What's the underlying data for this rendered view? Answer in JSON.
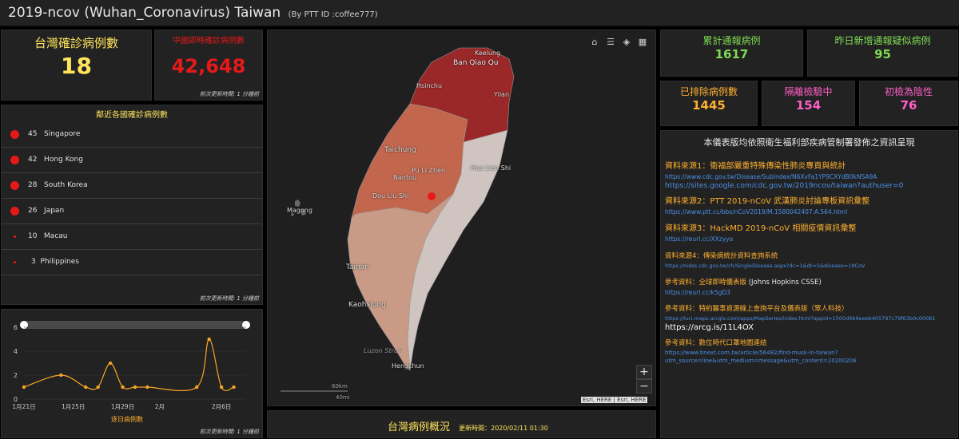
{
  "header": {
    "title": "2019-ncov (Wuhan_Coronavirus) Taiwan",
    "subtitle": "(By PTT ID :coffee777)"
  },
  "taiwan_cases": {
    "label": "台灣確診病例數",
    "value": "18"
  },
  "china_cases": {
    "label": "中國即時確診病例數",
    "value": "42,648",
    "note": "前次更新時間: 1 分鐘前"
  },
  "neighbors": {
    "title": "鄰近各國確診病例數",
    "note": "前次更新時間: 1 分鐘前",
    "items": [
      {
        "count": "45",
        "country": "Singapore"
      },
      {
        "count": "42",
        "country": "Hong Kong"
      },
      {
        "count": "28",
        "country": "South Korea"
      },
      {
        "count": "26",
        "country": "Japan"
      },
      {
        "count": "10",
        "country": "Macau"
      },
      {
        "count": "3",
        "country": "Philippines"
      }
    ]
  },
  "daily_chart": {
    "note": "前次更新時間: 1 分鐘前",
    "colors": {
      "line": "#f5a623",
      "grid": "#3a3a3a",
      "track": "#4a4a4a"
    }
  },
  "chart_data": {
    "type": "line",
    "xlabel": "逐日病例數",
    "ylim": [
      0,
      6
    ],
    "yticks": [
      "0",
      "2",
      "4",
      "6"
    ],
    "xticks": [
      "1月21日",
      "1月25日",
      "1月29日",
      "2月",
      "2月6日"
    ],
    "xtick_positions": [
      0,
      4,
      8,
      11,
      16
    ],
    "x": [
      0,
      3,
      5,
      6,
      7,
      8,
      9,
      10,
      14,
      15,
      16,
      17
    ],
    "values": [
      1,
      2,
      1,
      1,
      3,
      1,
      1,
      1,
      1,
      5,
      1,
      1
    ],
    "xmax": 18
  },
  "map": {
    "labels": [
      "Keelung",
      "Ban Qiao Qu",
      "Hsinchu",
      "Yilan",
      "Taichung",
      "Pu Li Zhen",
      "Nantou",
      "Hua Lien Shi",
      "Dou Liu Shi",
      "Magong",
      "Tainan",
      "Kaohsiung",
      "Luzon Strait",
      "Hengchun"
    ],
    "scale_km": "60km",
    "scale_mi": "40mi",
    "attribution": "Esri, HERE | Esri, HERE",
    "zoom_in": "+",
    "zoom_out": "−",
    "colors": {
      "north": "#9a2828",
      "central": "#c3664e",
      "south": "#c99a86",
      "east": "#cfc4c0",
      "dot": "#e61919"
    }
  },
  "status": {
    "title": "台灣病例概況",
    "updated": "更新時間：2020/02/11 01:30"
  },
  "stats": {
    "total_reported": {
      "label": "累計通報病例",
      "value": "1617"
    },
    "new_suspected": {
      "label": "昨日新增通報疑似病例",
      "value": "95"
    },
    "excluded": {
      "label": "已排除病例數",
      "value": "1445"
    },
    "quarantine": {
      "label": "隔離檢驗中",
      "value": "154"
    },
    "negative": {
      "label": "初檢為陰性",
      "value": "76"
    }
  },
  "sources": {
    "heading": "本儀表版均依照衛生福利部疾病管制署發佈之資訊呈現",
    "items": [
      {
        "label": "資料來源1：衛福部嚴重特殊傳染性肺炎專頁與統計",
        "urls": [
          "https://www.cdc.gov.tw/Disease/SubIndex/N6XvFa1YP9CXYdB0kNSA9A",
          "https://sites.google.com/cdc.gov.tw/2019ncov/taiwan?authuser=0"
        ]
      },
      {
        "label": "資料來源2：PTT 2019-nCoV 武漢肺炎討論專板資訊彙整",
        "urls": [
          "https://www.ptt.cc/bbs/nCoV2019/M.1580042407.A.564.html"
        ]
      },
      {
        "label": "資料來源3：HackMD 2019-nCoV 相關疫情資訊彙整",
        "urls": [
          "https://reurl.cc/XXzyya"
        ]
      },
      {
        "label": "資料來源4：傳染病統計資料查詢系統",
        "urls": [
          "https://nidss.cdc.gov.tw/ch/SingleDisease.aspx?dc=1&dt=5&disease=19CoV"
        ]
      },
      {
        "label": "參考資料：全球即時儀表版",
        "extra": "(Johns Hopkins CSSE)",
        "urls": [
          "https://reurl.cc/k5gD3"
        ]
      },
      {
        "label": "參考資料：特約醫事資源線上查詢平台及儀表版（眾人科技）",
        "urls": [
          "https://luci.maps.arcgis.com/apps/MapSeries/index.html?appid=1500d4b9eeeb405797c79f63b0c00081",
          "https://arcg.is/11L4OX"
        ]
      },
      {
        "label": "參考資料：數位時代口罩地圖連結",
        "urls": [
          "https://www.bnext.com.tw/article/56482/find-musk-in-taiwan?",
          "utm_source=line&utm_medium=message&utm_content=20200206"
        ]
      }
    ]
  }
}
